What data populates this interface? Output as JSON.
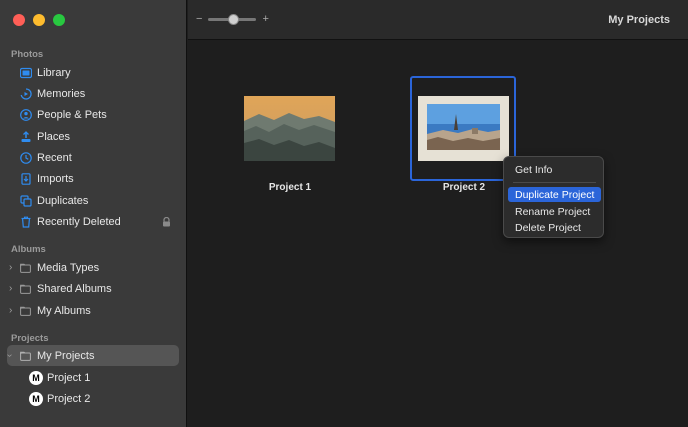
{
  "window": {
    "title": "My Projects"
  },
  "toolbar": {
    "zoom_minus": "−",
    "zoom_plus": "+",
    "zoom_level": 0.5
  },
  "sidebar": {
    "photos_label": "Photos",
    "photos_items": [
      {
        "label": "Library",
        "icon": "library-icon"
      },
      {
        "label": "Memories",
        "icon": "memories-icon"
      },
      {
        "label": "People & Pets",
        "icon": "people-icon"
      },
      {
        "label": "Places",
        "icon": "places-icon"
      },
      {
        "label": "Recent",
        "icon": "recent-icon"
      },
      {
        "label": "Imports",
        "icon": "imports-icon"
      },
      {
        "label": "Duplicates",
        "icon": "duplicates-icon"
      },
      {
        "label": "Recently Deleted",
        "icon": "trash-icon"
      }
    ],
    "albums_label": "Albums",
    "albums_items": [
      {
        "label": "Media Types"
      },
      {
        "label": "Shared Albums"
      },
      {
        "label": "My Albums"
      }
    ],
    "projects_label": "Projects",
    "projects_group": {
      "label": "My Projects"
    },
    "projects_items": [
      {
        "label": "Project 1",
        "badge": "M"
      },
      {
        "label": "Project 2",
        "badge": "M"
      }
    ]
  },
  "content": {
    "projects": [
      {
        "label": "Project 1"
      },
      {
        "label": "Project 2"
      }
    ]
  },
  "context_menu": {
    "items": [
      "Get Info",
      "Duplicate Project",
      "Rename Project",
      "Delete Project"
    ],
    "highlighted": "Duplicate Project"
  },
  "colors": {
    "accent": "#2b65d9",
    "sidebar_icon": "#2f8cf0"
  }
}
